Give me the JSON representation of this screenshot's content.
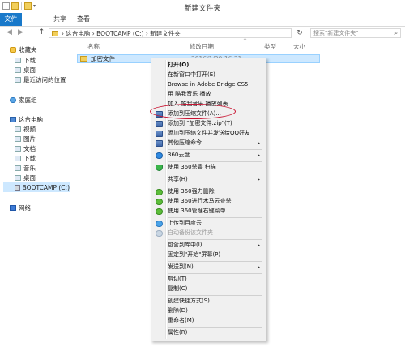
{
  "window": {
    "title": "新建文件夹",
    "quick_access_dropdown": "▾"
  },
  "ribbon": {
    "tabs": [
      "文件",
      "共享",
      "查看"
    ]
  },
  "navigation": {
    "back_icon": "◀",
    "forward_icon": "▶",
    "up_icon": "↑",
    "path": "› 这台电脑 › BOOTCAMP (C:) › 新建文件夹",
    "refresh_icon": "↻",
    "search_placeholder": "搜索\"新建文件夹\"",
    "search_icon": "⌕"
  },
  "sidebar": {
    "favorites": "收藏夹",
    "fav_items": [
      "下载",
      "桌面",
      "最近访问的位置"
    ],
    "homegroup": "家庭组",
    "this_pc": "这台电脑",
    "pc_items": [
      "视频",
      "图片",
      "文档",
      "下载",
      "音乐",
      "桌面",
      "BOOTCAMP (C:)"
    ],
    "network": "网络"
  },
  "columns": {
    "name": "名称",
    "date": "修改日期",
    "type": "类型",
    "size": "大小",
    "sort_arrow": "^"
  },
  "files": [
    {
      "name": "加密文件",
      "date": "2016/1/29 16:21"
    }
  ],
  "context_menu": {
    "items": [
      {
        "label": "打开(O)",
        "bold": true
      },
      {
        "label": "在新窗口中打开(E)"
      },
      {
        "label": "Browse in Adobe Bridge CS5"
      },
      {
        "label": "用 酷我音乐 播放"
      },
      {
        "label": "加入 酷我音乐 播放列表"
      },
      {
        "label": "添加到压缩文件(A)...",
        "icon": "rar-icon"
      },
      {
        "label": "添加到 \"加密文件.zip\"(T)",
        "icon": "rar-icon"
      },
      {
        "label": "添加到压缩文件并发送给QQ好友",
        "icon": "rar-icon"
      },
      {
        "label": "其他压缩命令",
        "icon": "rar-icon",
        "submenu": true
      },
      {
        "label": "360云盘",
        "icon": "cloud-360-icon",
        "submenu": true
      },
      {
        "label": "使用 360杀毒 扫描",
        "icon": "shield-360-icon"
      },
      {
        "label": "共享(H)",
        "submenu": true
      },
      {
        "label": "使用 360强力删除",
        "icon": "green-360-icon"
      },
      {
        "label": "使用 360进行木马云查杀",
        "icon": "green-360-icon"
      },
      {
        "label": "使用 360管理右键菜单",
        "icon": "green-360-icon"
      },
      {
        "label": "上传到百度云",
        "icon": "baidu-cloud-icon"
      },
      {
        "label": "自动备份该文件夹",
        "icon": "baidu-cloud-gray-icon"
      },
      {
        "label": "包含到库中(I)",
        "submenu": true
      },
      {
        "label": "固定到\"开始\"屏幕(P)"
      },
      {
        "label": "发送到(N)",
        "submenu": true
      },
      {
        "label": "剪切(T)"
      },
      {
        "label": "复制(C)"
      },
      {
        "label": "创建快捷方式(S)"
      },
      {
        "label": "删除(D)"
      },
      {
        "label": "重命名(M)"
      },
      {
        "label": "属性(R)"
      }
    ],
    "submenu_arrow": "▸"
  }
}
